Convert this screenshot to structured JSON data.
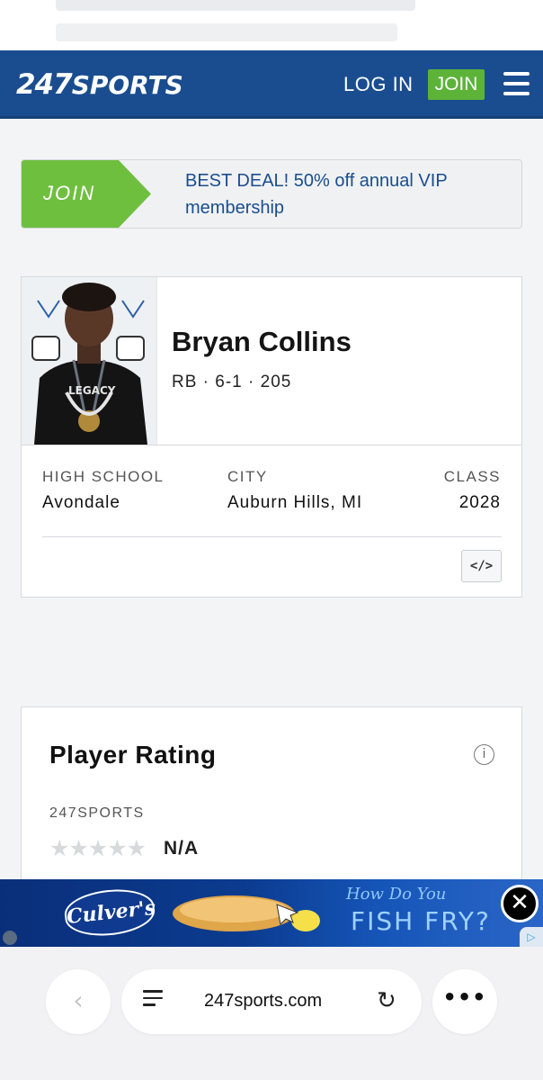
{
  "header": {
    "logo_247": "247",
    "logo_seven": "",
    "logo_sports": "SPORTS",
    "login_label": "LOG IN",
    "join_label": "JOIN"
  },
  "promo": {
    "join_label": "JOIN",
    "text": "BEST DEAL! 50% off annual VIP membership",
    "accent_color": "#6fbf3f"
  },
  "player": {
    "name": "Bryan Collins",
    "meta": "RB · 6-1 · 205",
    "high_school_label": "HIGH SCHOOL",
    "high_school": "Avondale",
    "city_label": "CITY",
    "city": "Auburn Hills, MI",
    "class_label": "CLASS",
    "class_year": "2028",
    "embed_label": "</>",
    "photo_text": "LEGACY"
  },
  "rating": {
    "title": "Player Rating",
    "info_icon": "i",
    "source": "247SPORTS",
    "stars": "★★★★★",
    "star_count": 0,
    "value": "N/A"
  },
  "ad": {
    "brand": "Culver's",
    "tagline_top": "How Do You",
    "tagline_bottom": "FISH FRY?",
    "close_label": "✕"
  },
  "browser": {
    "back_icon": "‹",
    "url": "247sports.com",
    "reload_icon": "↻",
    "more_icon": "•••"
  },
  "colors": {
    "header_bg": "#1a4d8f",
    "join_green": "#5cb338",
    "promo_text": "#1a4d8f"
  }
}
